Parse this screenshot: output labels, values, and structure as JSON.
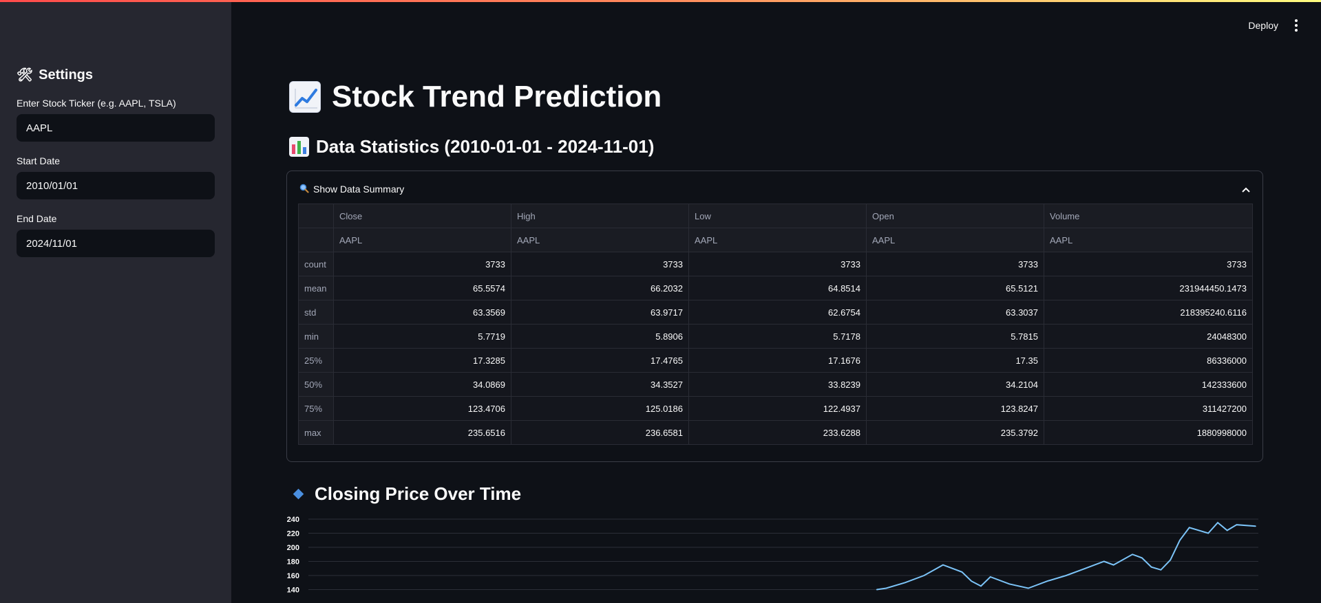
{
  "header": {
    "deploy_label": "Deploy",
    "menu_icon": "kebab-menu-icon"
  },
  "sidebar": {
    "title": "Settings",
    "title_icon": "hammer-and-wrench-icon",
    "ticker": {
      "label": "Enter Stock Ticker (e.g. AAPL, TSLA)",
      "value": "AAPL"
    },
    "start_date": {
      "label": "Start Date",
      "value": "2010/01/01"
    },
    "end_date": {
      "label": "End Date",
      "value": "2024/11/01"
    }
  },
  "main": {
    "title": "Stock Trend Prediction",
    "title_icon": "chart-increasing-icon",
    "stats_heading": "Data Statistics (2010-01-01 - 2024-11-01)",
    "stats_icon": "bar-chart-icon",
    "expander": {
      "label": "Show Data Summary",
      "icon": "magnifying-glass-icon",
      "expanded": true
    },
    "table": {
      "columns": [
        "Close",
        "High",
        "Low",
        "Open",
        "Volume"
      ],
      "sub_header": [
        "AAPL",
        "AAPL",
        "AAPL",
        "AAPL",
        "AAPL"
      ],
      "rows": [
        {
          "index": "count",
          "values": [
            "3733",
            "3733",
            "3733",
            "3733",
            "3733"
          ]
        },
        {
          "index": "mean",
          "values": [
            "65.5574",
            "66.2032",
            "64.8514",
            "65.5121",
            "231944450.1473"
          ]
        },
        {
          "index": "std",
          "values": [
            "63.3569",
            "63.9717",
            "62.6754",
            "63.3037",
            "218395240.6116"
          ]
        },
        {
          "index": "min",
          "values": [
            "5.7719",
            "5.8906",
            "5.7178",
            "5.7815",
            "24048300"
          ]
        },
        {
          "index": "25%",
          "values": [
            "17.3285",
            "17.4765",
            "17.1676",
            "17.35",
            "86336000"
          ]
        },
        {
          "index": "50%",
          "values": [
            "34.0869",
            "34.3527",
            "33.8239",
            "34.2104",
            "142333600"
          ]
        },
        {
          "index": "75%",
          "values": [
            "123.4706",
            "125.0186",
            "122.4937",
            "123.8247",
            "311427200"
          ]
        },
        {
          "index": "max",
          "values": [
            "235.6516",
            "236.6581",
            "233.6288",
            "235.3792",
            "1880998000"
          ]
        }
      ]
    },
    "chart_heading": "Closing Price Over Time",
    "chart_heading_icon": "blue-diamond-icon"
  },
  "colors": {
    "accent": "#4a8fe0",
    "line": "#7cc4f8",
    "background": "#0e1117",
    "sidebar": "#262730"
  },
  "chart_data": {
    "type": "line",
    "title": "Closing Price Over Time",
    "ylabel": "",
    "xlabel": "",
    "ylim": [
      140,
      240
    ],
    "yticks": [
      140,
      160,
      180,
      200,
      220,
      240
    ],
    "grid": true,
    "series": [
      {
        "x": [
          0.6,
          0.61,
          0.63,
          0.65,
          0.67,
          0.69,
          0.7,
          0.71,
          0.72,
          0.74,
          0.76,
          0.78,
          0.8,
          0.82,
          0.84,
          0.85,
          0.87,
          0.88,
          0.89,
          0.9,
          0.91,
          0.92,
          0.93,
          0.95,
          0.96,
          0.97,
          0.98,
          1.0
        ],
        "values": [
          140,
          142,
          150,
          160,
          175,
          165,
          152,
          145,
          158,
          148,
          142,
          152,
          160,
          170,
          180,
          175,
          190,
          185,
          172,
          168,
          182,
          210,
          228,
          220,
          235,
          224,
          232,
          230
        ]
      }
    ]
  }
}
